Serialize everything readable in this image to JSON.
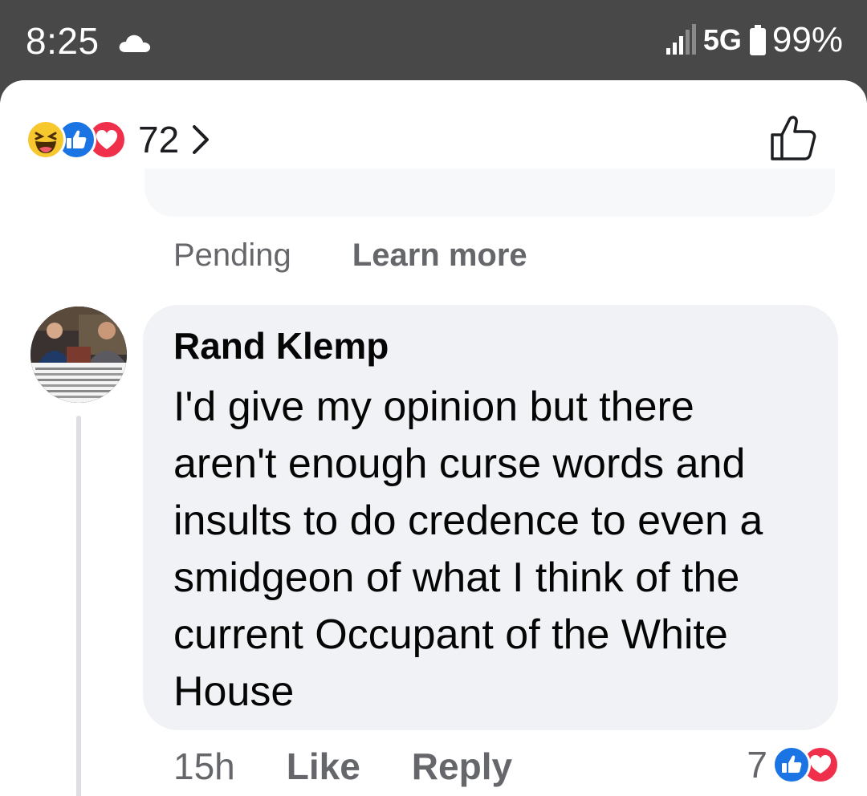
{
  "status_bar": {
    "time": "8:25",
    "cloud_icon": "cloud-icon",
    "network": "5G",
    "battery": "99%"
  },
  "reactions": {
    "types": [
      "haha",
      "like",
      "love"
    ],
    "count": "72",
    "colors": {
      "like": "#1b74e4",
      "love": "#f0304a",
      "haha": "#f7c82e"
    }
  },
  "pending": {
    "label": "Pending",
    "learn_more": "Learn more"
  },
  "comment": {
    "author": "Rand Klemp",
    "text": "I'd give my opinion but there aren't enough curse words and insults to do credence to even a smidgeon of what I think of the current Occupant of the White House",
    "time": "15h",
    "like_label": "Like",
    "reply_label": "Reply",
    "reaction_count": "7",
    "reaction_types": [
      "like",
      "love"
    ]
  }
}
